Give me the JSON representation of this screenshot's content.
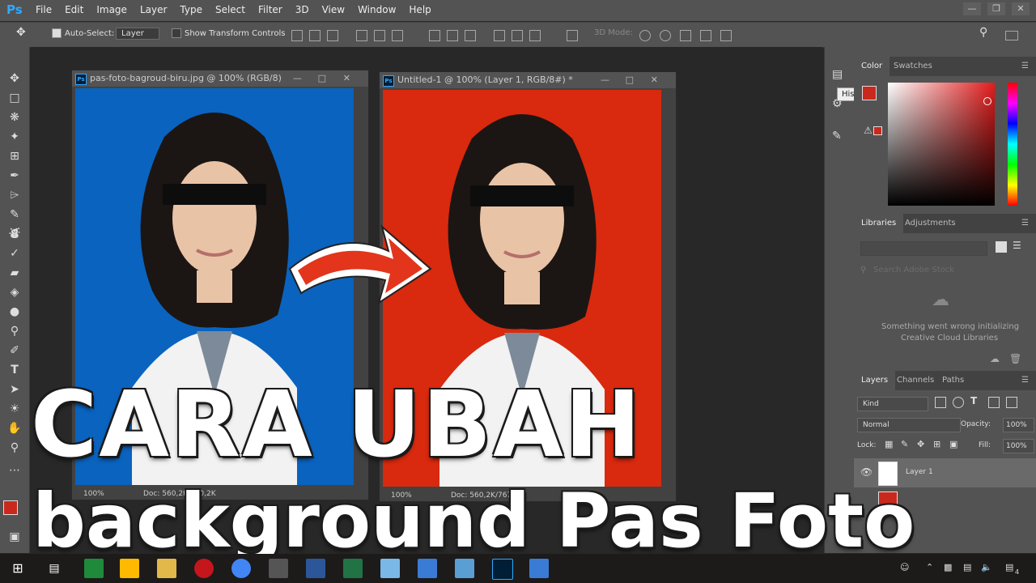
{
  "app": {
    "logo": "Ps"
  },
  "menubar": {
    "items": [
      "File",
      "Edit",
      "Image",
      "Layer",
      "Type",
      "Select",
      "Filter",
      "3D",
      "View",
      "Window",
      "Help"
    ]
  },
  "options": {
    "auto_select_label": "Auto-Select:",
    "auto_select_value": "Layer",
    "show_transform_label": "Show Transform Controls",
    "mode_3d_label": "3D Mode:"
  },
  "documents": [
    {
      "title": "pas-foto-bagroud-biru.jpg @ 100% (RGB/8)",
      "zoom": "100%",
      "doc": "Doc: 560,2K/560,2K",
      "bg_color": "#0a63bf"
    },
    {
      "title": "Untitled-1 @ 100% (Layer 1, RGB/8#) *",
      "zoom": "100%",
      "doc": "Doc: 560,2K/767,0K",
      "bg_color": "#d9290e"
    }
  ],
  "tooltip": {
    "text": "History"
  },
  "color_panel": {
    "tabs": [
      "Color",
      "Swatches"
    ]
  },
  "libraries_panel": {
    "tabs": [
      "Libraries",
      "Adjustments"
    ],
    "search_placeholder": "Search Adobe Stock",
    "error_line1": "Something went wrong initializing",
    "error_line2": "Creative Cloud Libraries"
  },
  "layers_panel": {
    "tabs": [
      "Layers",
      "Channels",
      "Paths"
    ],
    "kind_label": "Kind",
    "blend_mode": "Normal",
    "opacity_label": "Opacity:",
    "opacity_value": "100%",
    "lock_label": "Lock:",
    "fill_label": "Fill:",
    "fill_value": "100%",
    "layers": [
      {
        "name": "Layer 1"
      }
    ]
  },
  "overlay": {
    "line1": "CARA UBAH",
    "line2": "background Pas Foto"
  },
  "taskbar": {
    "tray_badge": "4"
  },
  "colors": {
    "accent": "#31a8ff",
    "ui_dark": "#535353",
    "red_swatch": "#c9291d"
  }
}
